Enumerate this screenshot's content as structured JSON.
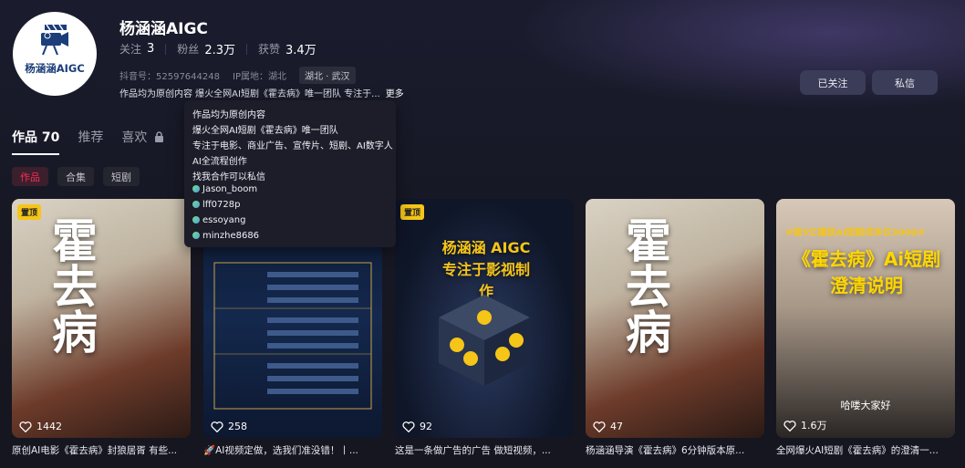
{
  "profile": {
    "avatar_text": "杨涵涵AIGC",
    "name": "杨涵涵AIGC",
    "stats": [
      {
        "label": "关注",
        "value": "3"
      },
      {
        "label": "粉丝",
        "value": "2.3万"
      },
      {
        "label": "获赞",
        "value": "3.4万"
      }
    ],
    "douyin_id": "抖音号：52597644248",
    "ip_location": "IP属地：湖北",
    "location_tag": "湖北 · 武汉",
    "bio_short": "作品均为原创内容 爆火全网AI短剧《霍去病》唯一团队 专注于...",
    "more_label": "更多",
    "follow_button": "已关注",
    "message_button": "私信"
  },
  "bio_popup": {
    "lines": [
      "作品均为原创内容",
      "爆火全网AI短剧《霍去病》唯一团队",
      "专注于电影、商业广告、宣传片、短剧、AI数字人",
      "AI全流程创作",
      "找我合作可以私信"
    ],
    "contacts": [
      "Jason_boom",
      "lff0728p",
      "essoyang",
      "minzhe8686"
    ]
  },
  "tabs": [
    {
      "label": "作品 70",
      "active": true
    },
    {
      "label": "推荐",
      "active": false
    },
    {
      "label": "喜欢",
      "active": false,
      "icon": "lock-icon"
    }
  ],
  "chips": [
    {
      "label": "作品",
      "active": true
    },
    {
      "label": "合集",
      "active": false
    },
    {
      "label": "短剧",
      "active": false
    }
  ],
  "cards": [
    {
      "pin": "置顶",
      "overlay": "霍去病",
      "likes": "1442",
      "caption": "原创AI电影《霍去病》封狼居胥 有些..."
    },
    {
      "pin": "",
      "overlay": "",
      "likes": "258",
      "caption": "🚀AI视频定做，选我们准没错！丨..."
    },
    {
      "pin": "置顶",
      "overlay": "杨涵涵 AIGC 专注于影视制作",
      "likes": "92",
      "caption": "这是一条做广告的广告 做短视频，..."
    },
    {
      "pin": "",
      "overlay": "霍去病",
      "likes": "47",
      "caption": "杨涵涵导演《霍去病》6分钟版本原..."
    },
    {
      "pin": "",
      "overlay": "《霍去病》Ai短剧 澄清说明",
      "likes": "1.6万",
      "caption": "全网爆火AI短剧《霍去病》的澄清一..."
    }
  ],
  "card5_banner": "#破5亿播放AI短剧成本仅3000#",
  "card5_subtitle": "哈喽大家好",
  "colors": {
    "accent": "#fe2c55",
    "pin": "#f5c518",
    "button": "#3a3c58"
  }
}
